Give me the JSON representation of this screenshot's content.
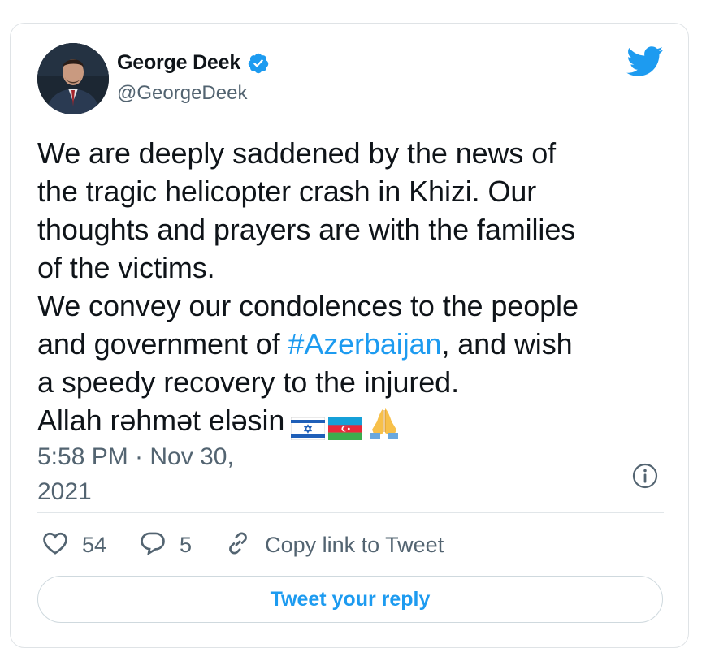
{
  "author": {
    "display_name": "George Deek",
    "handle": "@GeorgeDeek",
    "verified": true
  },
  "tweet": {
    "lines": [
      "We are deeply saddened by the news of",
      "the tragic helicopter crash in Khizi. Our",
      "thoughts and prayers are with the families",
      "of the victims.",
      "We convey our condolences to the people"
    ],
    "line6_before": "and government of ",
    "hashtag": "#Azerbaijan",
    "line6_after": ", and wish",
    "line7": "a speedy recovery to the injured.",
    "line8": "Allah rəhmət eləsin",
    "emojis": [
      "israel-flag",
      "azerbaijan-flag",
      "folded-hands"
    ]
  },
  "timestamp": {
    "line1": "5:58 PM · Nov 30,",
    "line2": "2021"
  },
  "actions": {
    "likes_count": "54",
    "replies_count": "5",
    "copy_link_label": "Copy link to Tweet"
  },
  "reply_button": {
    "label": "Tweet your reply"
  },
  "colors": {
    "accent": "#1d9bf0",
    "text": "#0f1419",
    "muted": "#536471",
    "border": "#dfe3e6"
  },
  "icons": [
    "verified-badge-icon",
    "twitter-bird-icon",
    "info-icon",
    "heart-icon",
    "reply-bubble-icon",
    "link-icon"
  ]
}
